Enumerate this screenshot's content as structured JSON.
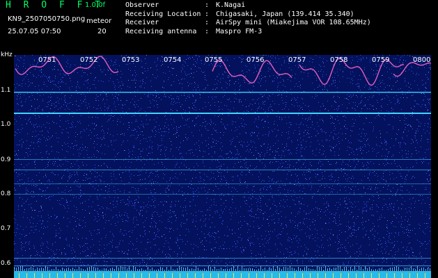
{
  "header": {
    "logo": "H R O F F T",
    "version": "1.0.0f",
    "filename": "KN9_2507050750.png",
    "datetime": "25.07.05 07:50",
    "meteor_label": "meteor",
    "meteor_count": "20",
    "meta": [
      {
        "key": "Observer",
        "value": "K.Nagai"
      },
      {
        "key": "Receiving Location",
        "value": "Chigasaki, Japan (139.414 35.340)"
      },
      {
        "key": "Receiver",
        "value": "AirSpy mini (Miakejima VOR 108.65MHz)"
      },
      {
        "key": "Receiving antenna",
        "value": "Maspro FM-3"
      }
    ]
  },
  "axis": {
    "unit": "kHz",
    "y_labels": [
      "1.1",
      "1.0",
      "0.9",
      "0.8",
      "0.7",
      "0.6"
    ],
    "time_labels": [
      "0751",
      "0752",
      "0753",
      "0754",
      "0755",
      "0756",
      "0757",
      "0758",
      "0759",
      "0800"
    ]
  },
  "colors": {
    "background": "#000000",
    "plot_bg": "#04125e",
    "noise": "#3a5cff",
    "line": "#3fd6ff",
    "trace": "#ff66c4",
    "text": "#ffffff",
    "logo": "#00ff66",
    "bottom_band": "#2fd7ff"
  }
}
